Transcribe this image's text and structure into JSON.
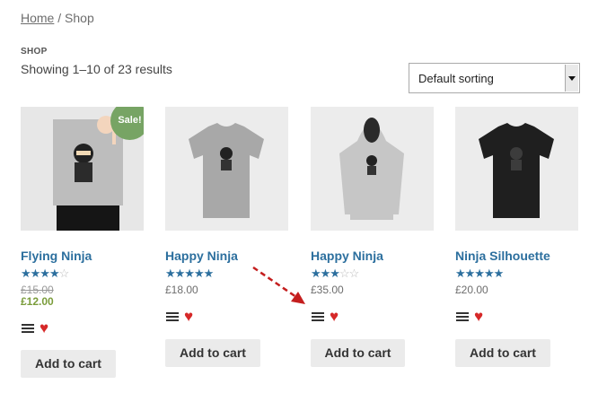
{
  "breadcrumb": {
    "home": "Home",
    "separator": " / ",
    "current": "Shop"
  },
  "shop_label": "SHOP",
  "result_count": "Showing 1–10 of 23 results",
  "sorting": {
    "selected": "Default sorting"
  },
  "products": [
    {
      "title": "Flying Ninja",
      "rating": 4,
      "old_price": "£15.00",
      "price": "£12.00",
      "sale_badge": "Sale!",
      "cart_label": "Add to cart"
    },
    {
      "title": "Happy Ninja",
      "rating": 5,
      "price": "£18.00",
      "cart_label": "Add to cart"
    },
    {
      "title": "Happy Ninja",
      "rating": 3,
      "price": "£35.00",
      "cart_label": "Add to cart"
    },
    {
      "title": "Ninja Silhouette",
      "rating": 5,
      "price": "£20.00",
      "cart_label": "Add to cart"
    }
  ],
  "icons": {
    "menu": "menu-icon",
    "wishlist": "heart-icon"
  },
  "colors": {
    "accent": "#2c6f9e",
    "sale": "#77a464",
    "heart": "#d62828",
    "annotation_arrow": "#c41e1e"
  }
}
